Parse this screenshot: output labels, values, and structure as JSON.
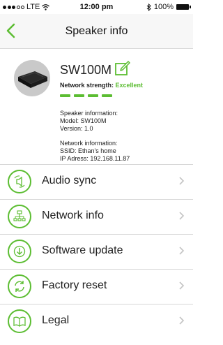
{
  "status": {
    "carrier": "LTE",
    "time": "12:00 pm",
    "battery": "100%"
  },
  "nav": {
    "title": "Speaker info"
  },
  "speaker": {
    "name": "SW100M",
    "strength_label": "Network strength:",
    "strength_value": "Excellent",
    "strength_level": 4,
    "speaker_info_heading": "Speaker information:",
    "model": "Model: SW100M",
    "version": "Version: 1.0",
    "network_info_heading": "Network information:",
    "ssid": "SSID: Ethan's home",
    "ip": "IP Adress: 192.168.11.87"
  },
  "colors": {
    "accent": "#5cbd32"
  },
  "menu": [
    {
      "label": "Audio sync",
      "icon": "speaker-sync-icon"
    },
    {
      "label": "Network info",
      "icon": "network-icon"
    },
    {
      "label": "Software update",
      "icon": "download-icon"
    },
    {
      "label": "Factory reset",
      "icon": "reset-icon"
    },
    {
      "label": "Legal",
      "icon": "book-icon"
    }
  ]
}
